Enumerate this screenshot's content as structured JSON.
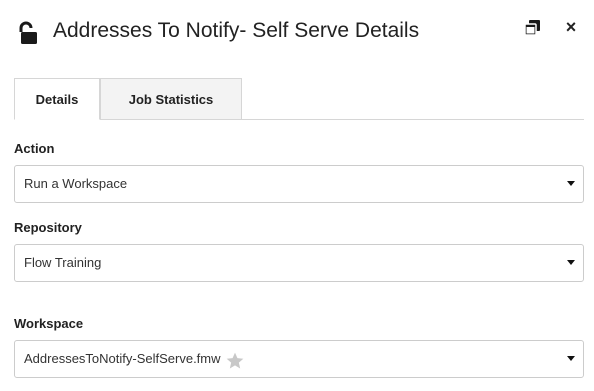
{
  "dialog": {
    "title": "Addresses To Notify- Self Serve Details",
    "lock_icon": "unlock-icon",
    "popout_icon": "popout-window-icon",
    "close_label": "×"
  },
  "tabs": [
    {
      "label": "Details",
      "active": true
    },
    {
      "label": "Job Statistics",
      "active": false
    }
  ],
  "fields": {
    "action": {
      "label": "Action",
      "value": "Run a Workspace"
    },
    "repository": {
      "label": "Repository",
      "value": "Flow Training"
    },
    "workspace": {
      "label": "Workspace",
      "value": "AddressesToNotify-SelfServe.fmw",
      "favorite_icon": "star-icon"
    }
  },
  "colors": {
    "caret": "#111111",
    "star": "#c8c8c8",
    "border": "#cccccc",
    "inactive_tab_bg": "#f3f3f3"
  }
}
